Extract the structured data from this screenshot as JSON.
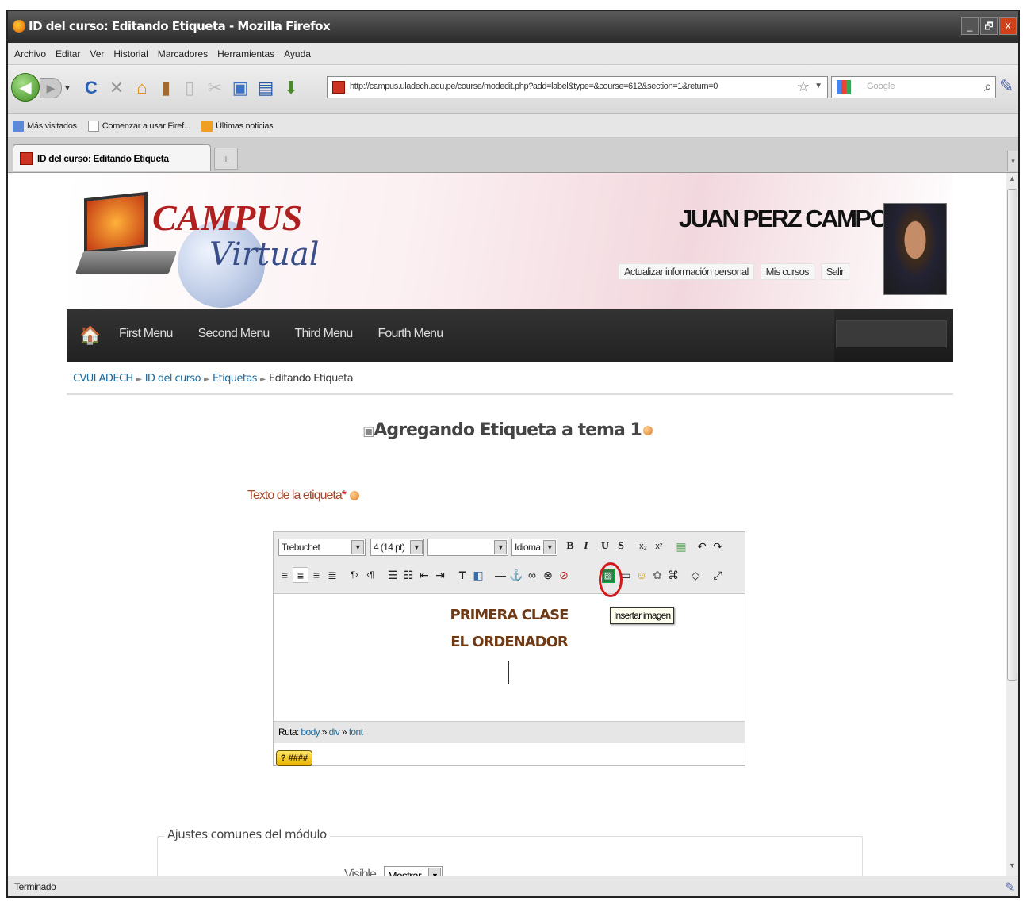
{
  "window": {
    "title": "ID del curso: Editando Etiqueta - Mozilla Firefox",
    "buttons": [
      "_",
      "🗗",
      "X"
    ]
  },
  "menubar": {
    "items": [
      "Archivo",
      "Editar",
      "Ver",
      "Historial",
      "Marcadores",
      "Herramientas",
      "Ayuda"
    ]
  },
  "navbar": {
    "url": "http://campus.uladech.edu.pe/course/modedit.php?add=label&type=&course=612&section=1&return=0",
    "search_placeholder": "Google"
  },
  "bookmarks": {
    "items": [
      "Más visitados",
      "Comenzar a usar Firef...",
      "Últimas noticias"
    ]
  },
  "tab": {
    "title": "ID del curso: Editando Etiqueta",
    "new_tab": "+"
  },
  "site": {
    "logo_campus": "CAMPUS",
    "logo_virtual": "Virtual",
    "user_name": "JUAN PERZ CAMPOS",
    "user_links": [
      "Actualizar información personal",
      "Mis cursos",
      "Salir"
    ],
    "nav_items": [
      "First Menu",
      "Second Menu",
      "Third Menu",
      "Fourth Menu"
    ]
  },
  "breadcrumb": {
    "items": [
      "CVULADECH",
      "ID del curso",
      "Etiquetas",
      "Editando Etiqueta"
    ],
    "separator": "►"
  },
  "heading": "Agregando Etiqueta a tema 1",
  "form": {
    "label_text": "Texto de la etiqueta",
    "required_mark": "*",
    "font_family": "Trebuchet",
    "font_size": "4 (14 pt)",
    "language": "Idioma",
    "content_line1": "PRIMERA CLASE",
    "content_line2": "EL ORDENADOR",
    "tooltip": "Insertar imagen",
    "path_label": "Ruta:",
    "path": [
      "body",
      "div",
      "font"
    ],
    "path_sep": "»",
    "help_badge": "? ####",
    "fieldset_legend": "Ajustes comunes del módulo",
    "visible_label": "Visible",
    "visible_value": "Mostrar"
  },
  "status": "Terminado"
}
